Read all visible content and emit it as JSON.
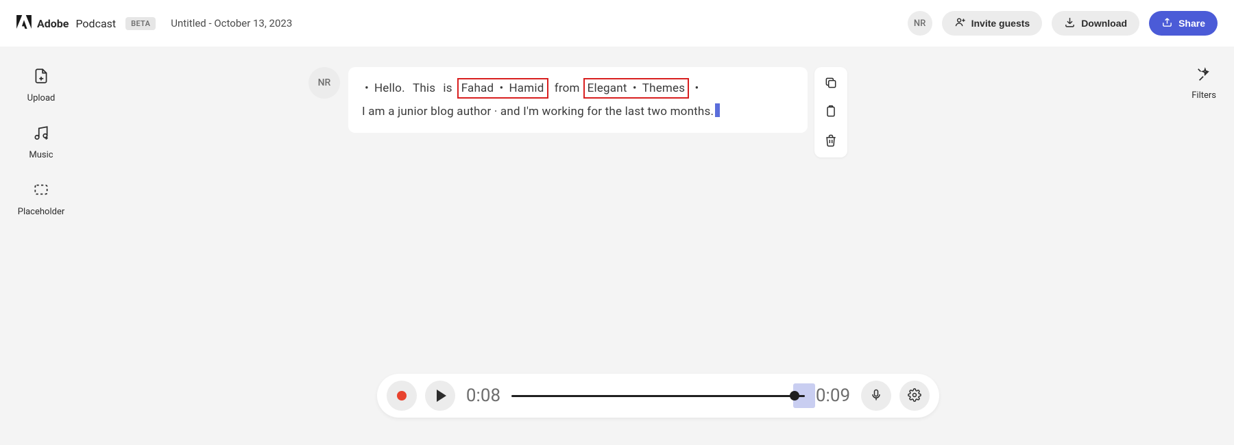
{
  "header": {
    "brand_main": "Adobe",
    "brand_sub": "Podcast",
    "beta": "BETA",
    "doc_title": "Untitled - October 13, 2023",
    "avatar_initials": "NR",
    "invite_label": "Invite guests",
    "download_label": "Download",
    "share_label": "Share"
  },
  "sidebar_left": {
    "upload": "Upload",
    "music": "Music",
    "placeholder": "Placeholder"
  },
  "sidebar_right": {
    "filters": "Filters"
  },
  "transcript": {
    "speaker_initials": "NR",
    "words_line1_pre": "Hello.",
    "w_this": "This",
    "w_is": "is",
    "hl1_a": "Fahad",
    "hl1_b": "Hamid",
    "w_from": "from",
    "hl2_a": "Elegant",
    "hl2_b": "Themes",
    "line2": "I  am  a  junior  blog  author · and  I'm  working  for  the  last  two  months."
  },
  "player": {
    "time_current": "0:08",
    "time_total": "0:09"
  }
}
